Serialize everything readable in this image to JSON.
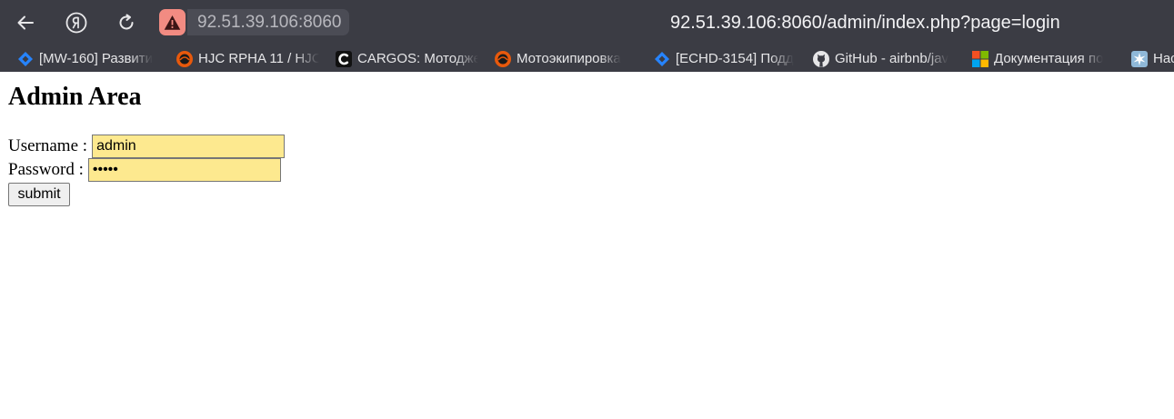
{
  "browser": {
    "omnibox_text": "92.51.39.106:8060",
    "page_url": "92.51.39.106:8060/admin/index.php?page=login",
    "icons": {
      "back": "back-arrow-icon",
      "yandex": "yandex-logo-icon",
      "reload": "reload-icon",
      "security": "warning-triangle-icon"
    },
    "colors": {
      "toolbar_bg": "#3b3c44",
      "security_badge": "#f28b82"
    }
  },
  "bookmarks": [
    {
      "label": "[MW-160] Развити",
      "icon": "jira-icon"
    },
    {
      "label": "HJC RPHA 11 / HJC",
      "icon": "motorcycle-site-icon"
    },
    {
      "label": "CARGOS: Мотодже",
      "icon": "cargos-icon"
    },
    {
      "label": "Мотоэкипировка",
      "icon": "motorcycle-site-icon"
    },
    {
      "label": "[ECHD-3154] Подд",
      "icon": "jira-icon"
    },
    {
      "label": "GitHub - airbnb/jav",
      "icon": "github-icon"
    },
    {
      "label": "Документация по",
      "icon": "microsoft-icon"
    },
    {
      "label": "Нас",
      "icon": "settings-star-icon"
    }
  ],
  "page": {
    "heading": "Admin Area",
    "username_label": "Username :",
    "username_value": "admin",
    "password_label": "Password :",
    "password_value": "•••••",
    "submit_label": "submit",
    "colors": {
      "autofill_bg": "#fde98f"
    }
  }
}
